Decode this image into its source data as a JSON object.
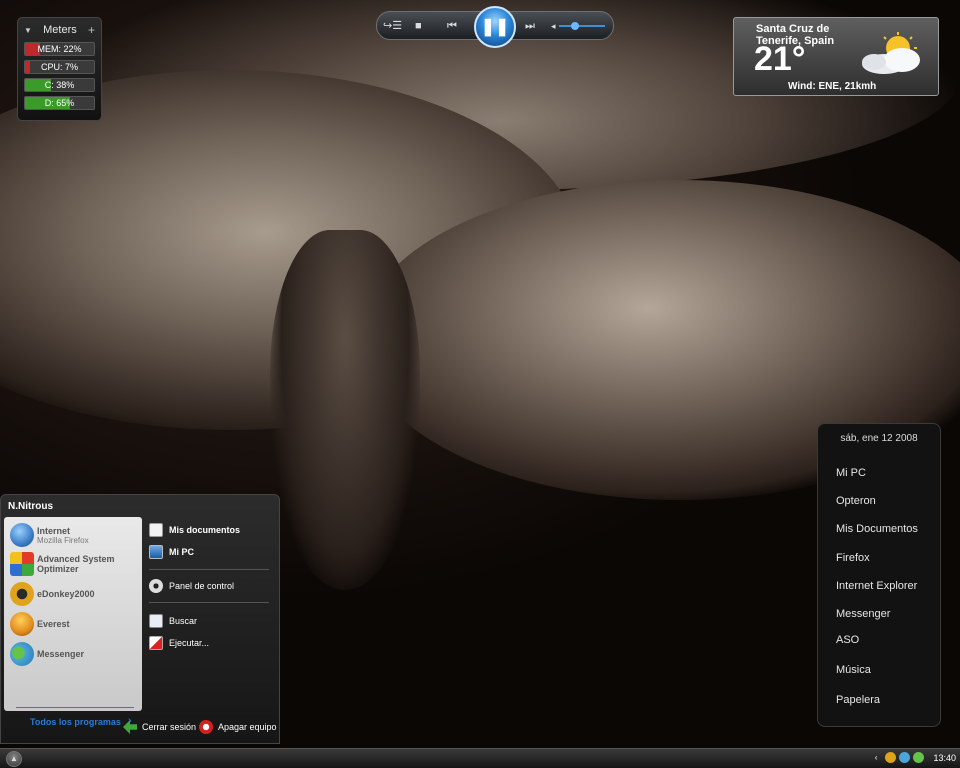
{
  "meters": {
    "title": "Meters",
    "items": [
      {
        "label": "MEM: 22%",
        "value": 0.22,
        "color": "#c0282a"
      },
      {
        "label": "CPU: 7%",
        "value": 0.07,
        "color": "#c0282a"
      },
      {
        "label": "C: 38%",
        "value": 0.38,
        "color": "#3c9a2a"
      },
      {
        "label": "D: 65%",
        "value": 0.65,
        "color": "#3c9a2a"
      }
    ]
  },
  "player": {
    "switch_icon": "switch-to-library-icon",
    "stop_icon": "stop-icon",
    "prev_icon": "previous-track-icon",
    "play_icon": "pause-icon",
    "next_icon": "next-track-icon",
    "volume_icon": "volume-icon"
  },
  "weather": {
    "city": "Santa Cruz de Tenerife, Spain",
    "temperature": "21°",
    "wind": "Wind: ENE, 21kmh",
    "condition_icon": "partly-cloudy-icon"
  },
  "launcher": {
    "date": "sáb, ene 12 2008",
    "items": [
      "Mi PC",
      "Opteron",
      "Mis Documentos",
      "Firefox",
      "Internet Explorer",
      "Messenger",
      "ASO",
      "Música",
      "Papelera"
    ]
  },
  "startmenu": {
    "user": "N.Nitrous",
    "programs": [
      {
        "label": "Internet",
        "sub": "Mozilla Firefox",
        "icon": "firefox-icon",
        "color": "#3a7cc4"
      },
      {
        "label": "Advanced System Optimizer",
        "sub": "",
        "icon": "optimizer-icon",
        "color": "#d3a21e"
      },
      {
        "label": "eDonkey2000",
        "sub": "",
        "icon": "edonkey-icon",
        "color": "#e0a41c"
      },
      {
        "label": "Everest",
        "sub": "",
        "icon": "everest-icon",
        "color": "#e08a1c"
      },
      {
        "label": "Messenger",
        "sub": "",
        "icon": "messenger-icon",
        "color": "#4ba5d8"
      }
    ],
    "all_programs": "Todos los programas",
    "places": [
      {
        "label": "Mis documentos",
        "icon": "documents-icon"
      },
      {
        "label": "Mi PC",
        "icon": "computer-icon"
      }
    ],
    "control_panel": "Panel de control",
    "search": "Buscar",
    "run": "Ejecutar...",
    "logoff": "Cerrar sesión",
    "shutdown": "Apagar equipo"
  },
  "taskbar": {
    "clock": "13:40"
  }
}
